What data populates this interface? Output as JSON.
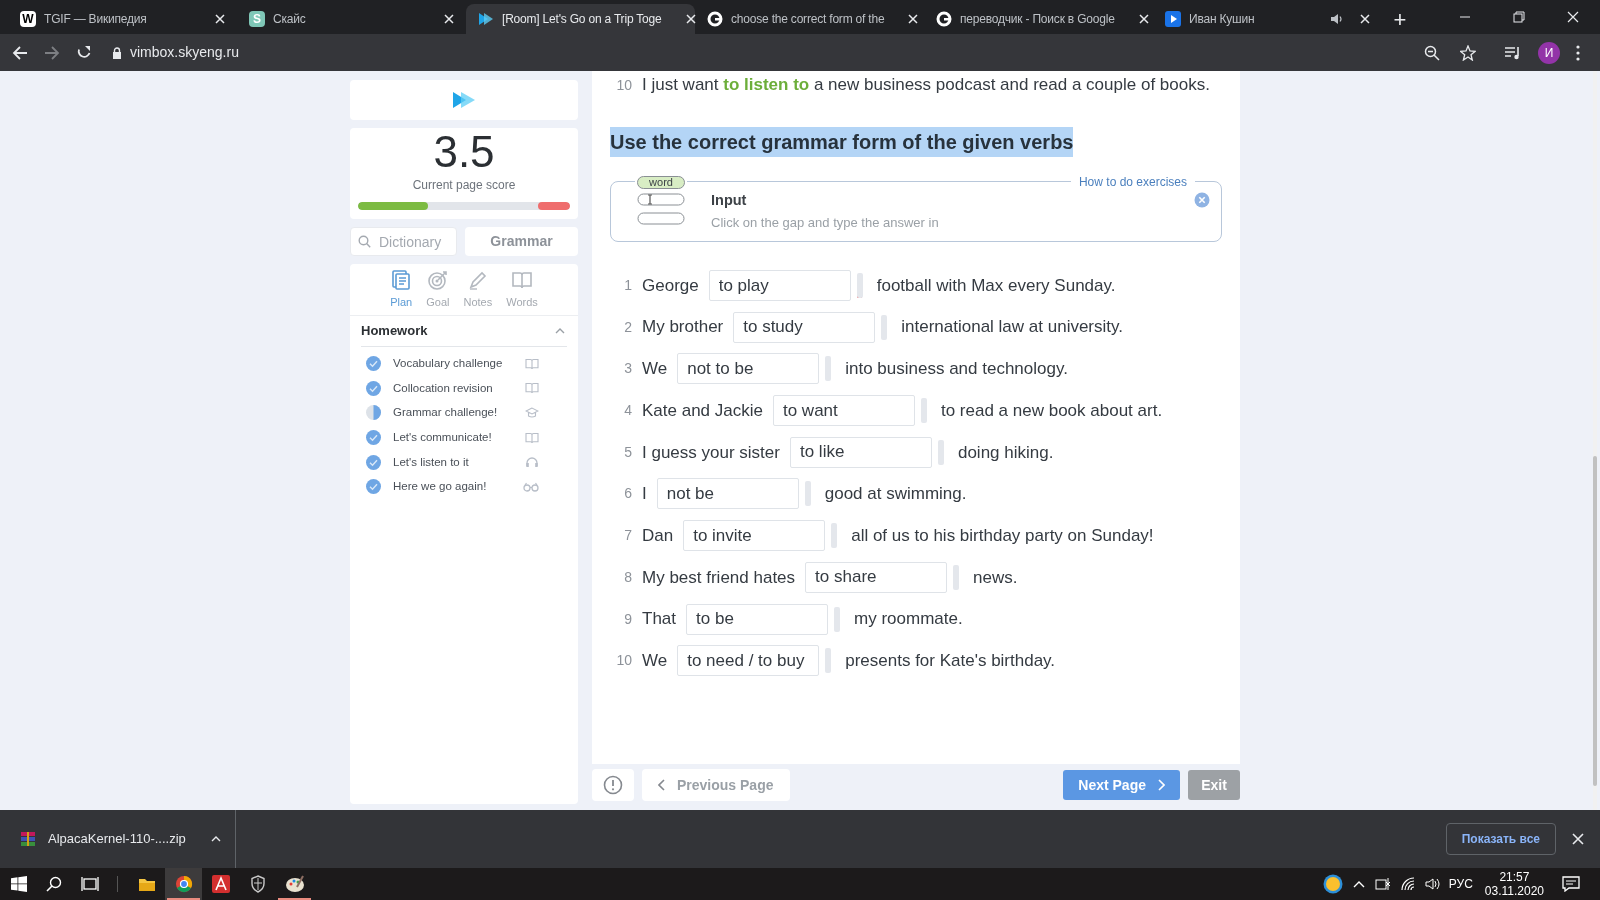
{
  "browser": {
    "tabs": [
      {
        "label": "TGIF — Википедия",
        "kind": "wiki",
        "icon_text": "W",
        "selected": false,
        "audio": false
      },
      {
        "label": "Скайс",
        "kind": "letter",
        "icon_text": "S",
        "selected": false,
        "audio": false
      },
      {
        "label": "[Room] Let's Go on a Trip Toge",
        "kind": "play",
        "selected": true,
        "audio": false
      },
      {
        "label": "choose the correct form of the",
        "kind": "google",
        "selected": false,
        "audio": false
      },
      {
        "label": "переводчик - Поиск в Google",
        "kind": "google",
        "selected": false,
        "audio": false
      },
      {
        "label": "Иван Кушин",
        "kind": "video",
        "selected": false,
        "audio": true
      }
    ],
    "new_tab": "+",
    "url": "vimbox.skyeng.ru",
    "profile_initial": "И"
  },
  "sidebar": {
    "score": "3.5",
    "score_label": "Current page score",
    "score_bar": [
      {
        "kind": "correct",
        "level": 0.33
      },
      {
        "kind": "wrong",
        "level": 0.15
      }
    ],
    "dictionary": {
      "placeholder": "Dictionary"
    },
    "grammar": "Grammar",
    "nav": [
      {
        "label": "Plan",
        "kind": "plan",
        "selected": true
      },
      {
        "label": "Goal",
        "kind": "goal",
        "selected": false
      },
      {
        "label": "Notes",
        "kind": "notes",
        "selected": false
      },
      {
        "label": "Words",
        "kind": "book",
        "selected": false
      }
    ],
    "homework": {
      "title": "Homework",
      "expanded": true,
      "items": [
        {
          "label": "Vocabulary challenge",
          "checked": true,
          "partial": false,
          "kind": "book"
        },
        {
          "label": "Collocation revision",
          "checked": true,
          "partial": false,
          "kind": "book"
        },
        {
          "label": "Grammar challenge!",
          "checked": false,
          "partial": true,
          "kind": "cap"
        },
        {
          "label": "Let's communicate!",
          "checked": true,
          "partial": false,
          "kind": "book"
        },
        {
          "label": "Let's listen to it",
          "checked": true,
          "partial": false,
          "kind": "headphones"
        },
        {
          "label": "Here we go again!",
          "checked": true,
          "partial": false,
          "kind": "glasses"
        }
      ]
    }
  },
  "main": {
    "previous_line": {
      "number": "10",
      "before": "I just want ",
      "answer": "to listen to",
      "after": " a new business podcast and read a couple of books."
    },
    "heading": {
      "text": "Use the correct grammar form of the given verbs",
      "selected": true
    },
    "hint": {
      "picture_word": "word",
      "title": "Input",
      "text": "Click on the gap and type the answer in",
      "link": "How to do exercises"
    },
    "rows": [
      {
        "number": "1",
        "before": "George",
        "value": "to play",
        "after": "football with Max every Sunday.",
        "flagged": true
      },
      {
        "number": "2",
        "before": "My brother",
        "value": "to study",
        "after": "international law at university.",
        "flagged": false
      },
      {
        "number": "3",
        "before": "We",
        "value": "not to be",
        "after": "into business and technology.",
        "flagged": false
      },
      {
        "number": "4",
        "before": "Kate and Jackie",
        "value": "to want",
        "after": "to read a new book about art.",
        "flagged": false
      },
      {
        "number": "5",
        "before": "I guess your sister",
        "value": "to like",
        "after": "doing hiking.",
        "flagged": false
      },
      {
        "number": "6",
        "before": "I",
        "value": "not be",
        "after": "good at swimming.",
        "flagged": false
      },
      {
        "number": "7",
        "before": "Dan",
        "value": "to invite",
        "after": "all of us to his birthday party on Sunday!",
        "flagged": false
      },
      {
        "number": "8",
        "before": "My best friend hates",
        "value": "to share",
        "after": "news.",
        "flagged": false
      },
      {
        "number": "9",
        "before": "That",
        "value": "to be",
        "after": "my roommate.",
        "flagged": false
      },
      {
        "number": "10",
        "before": "We",
        "value": "to need / to buy",
        "after": "presents for Kate's birthday.",
        "flagged": false
      }
    ]
  },
  "footer": {
    "previous": "Previous Page",
    "next": "Next Page",
    "exit": "Exit"
  },
  "downloads": {
    "file": "AlpacaKernel-110-....zip",
    "show_all": "Показать все"
  },
  "taskbar": {
    "apps": [
      {
        "kind": "folder",
        "selected": false,
        "running": false
      },
      {
        "kind": "chrome",
        "selected": true,
        "running": true
      },
      {
        "kind": "acrobat",
        "selected": false,
        "running": false
      },
      {
        "kind": "shield",
        "selected": false,
        "running": false
      },
      {
        "kind": "paint",
        "selected": false,
        "running": true
      }
    ],
    "language": "РУС",
    "time": "21:57",
    "date": "03.11.2020"
  }
}
